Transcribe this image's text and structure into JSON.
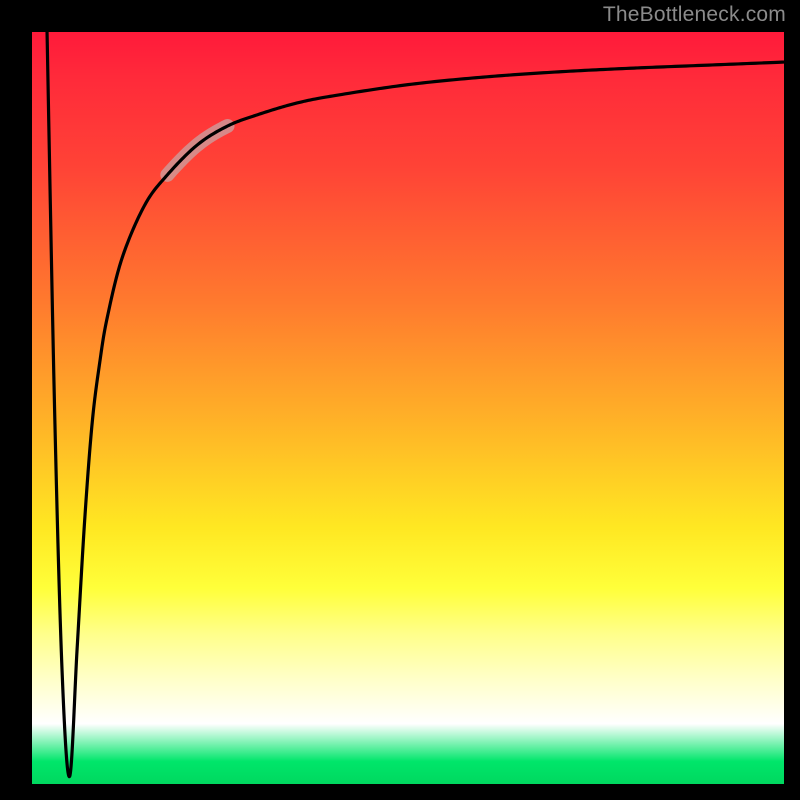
{
  "watermark": "TheBottleneck.com",
  "chart_data": {
    "type": "line",
    "title": "",
    "xlabel": "",
    "ylabel": "",
    "xlim": [
      0,
      100
    ],
    "ylim": [
      0,
      100
    ],
    "grid": false,
    "legend": false,
    "series": [
      {
        "name": "curve",
        "x": [
          2,
          3,
          4,
          5,
          6,
          7,
          8,
          9,
          10,
          12,
          15,
          18,
          22,
          26,
          30,
          35,
          40,
          50,
          60,
          70,
          80,
          90,
          100
        ],
        "y": [
          100,
          50,
          15,
          1,
          18,
          35,
          48,
          56,
          62,
          70,
          77,
          81,
          85,
          87.5,
          89,
          90.5,
          91.5,
          93,
          94,
          94.7,
          95.2,
          95.6,
          96
        ]
      }
    ],
    "highlight_segment": {
      "series": "curve",
      "x_start": 18,
      "x_end": 26
    },
    "background_gradient": {
      "direction": "vertical",
      "stops": [
        {
          "pos": 0.0,
          "color": "#ff1a3a"
        },
        {
          "pos": 0.18,
          "color": "#ff4336"
        },
        {
          "pos": 0.36,
          "color": "#ff7a2e"
        },
        {
          "pos": 0.52,
          "color": "#ffb327"
        },
        {
          "pos": 0.66,
          "color": "#ffe822"
        },
        {
          "pos": 0.8,
          "color": "#ffff8a"
        },
        {
          "pos": 0.92,
          "color": "#ffffff"
        },
        {
          "pos": 1.0,
          "color": "#00d85f"
        }
      ]
    }
  }
}
